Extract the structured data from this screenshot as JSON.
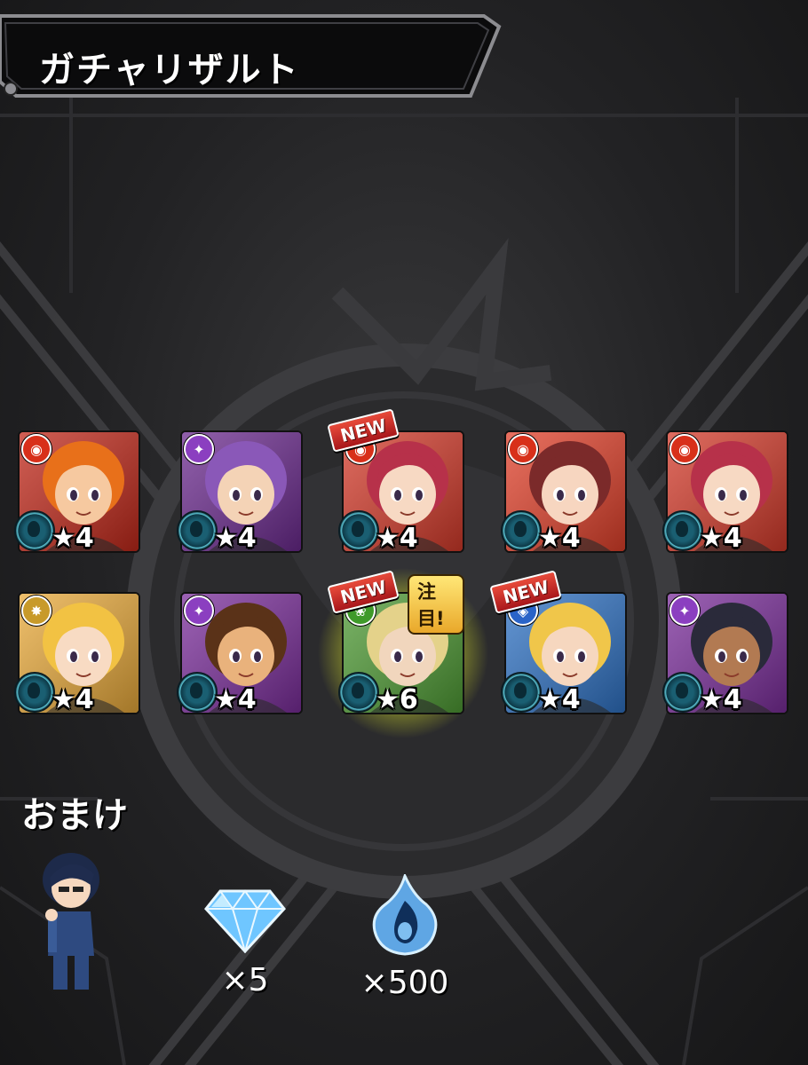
{
  "header": {
    "title": "ガチャリザルト"
  },
  "theme": {
    "background": "#232325",
    "accent_yellow": "#f4e51e",
    "new_badge": "#c4221f"
  },
  "results": [
    {
      "stars": "★4",
      "element": "fire",
      "element_icon": "fire-element-icon",
      "element_color": "#d8301a",
      "bg": "#c0281a",
      "hair": "#e8701a",
      "skin": "#f6c9a0",
      "ability": "ability-orb-icon",
      "is_new": false,
      "is_featured": false
    },
    {
      "stars": "★4",
      "element": "dark",
      "element_icon": "dark-element-icon",
      "element_color": "#8b3fc0",
      "bg": "#6b2a8e",
      "hair": "#8a58b8",
      "skin": "#f4d3b6",
      "ability": "ability-orb-icon",
      "is_new": false,
      "is_featured": false
    },
    {
      "stars": "★4",
      "element": "fire",
      "element_icon": "fire-element-icon",
      "element_color": "#d8301a",
      "bg": "#d33a2a",
      "hair": "#b7314a",
      "skin": "#f7d9c3",
      "ability": "ability-orb-icon",
      "is_new": true,
      "is_featured": false
    },
    {
      "stars": "★4",
      "element": "fire",
      "element_icon": "fire-element-icon",
      "element_color": "#d8301a",
      "bg": "#e0402a",
      "hair": "#7b2a2a",
      "skin": "#f7d6c0",
      "ability": "ability-orb-icon",
      "is_new": false,
      "is_featured": false
    },
    {
      "stars": "★4",
      "element": "fire",
      "element_icon": "fire-element-icon",
      "element_color": "#d8301a",
      "bg": "#d33a2a",
      "hair": "#b7314a",
      "skin": "#f7d9c3",
      "ability": "ability-orb-icon",
      "is_new": false,
      "is_featured": false
    },
    {
      "stars": "★4",
      "element": "light",
      "element_icon": "light-element-icon",
      "element_color": "#c89a2a",
      "bg": "#e8a93a",
      "hair": "#f2c243",
      "skin": "#f8dbc3",
      "ability": "ability-orb-icon",
      "is_new": false,
      "is_featured": false
    },
    {
      "stars": "★4",
      "element": "dark",
      "element_icon": "dark-element-icon",
      "element_color": "#8b3fc0",
      "bg": "#7a2d9a",
      "hair": "#5a3218",
      "skin": "#e9b27c",
      "ability": "ability-orb-icon",
      "is_new": false,
      "is_featured": false
    },
    {
      "stars": "★6",
      "element": "wood",
      "element_icon": "wood-element-icon",
      "element_color": "#3f9a2a",
      "bg": "#4e9a34",
      "hair": "#e4d28a",
      "skin": "#f1d6bd",
      "ability": "ability-orb-icon",
      "is_new": true,
      "is_featured": true
    },
    {
      "stars": "★4",
      "element": "water",
      "element_icon": "water-element-icon",
      "element_color": "#2a64c8",
      "bg": "#2f72c4",
      "hair": "#f0c64a",
      "skin": "#f6d7bf",
      "ability": "ability-orb-icon",
      "is_new": true,
      "is_featured": false
    },
    {
      "stars": "★4",
      "element": "dark",
      "element_icon": "dark-element-icon",
      "element_color": "#8b3fc0",
      "bg": "#7a2d9a",
      "hair": "#2a2a3a",
      "skin": "#b27a52",
      "ability": "ability-orb-icon",
      "is_new": false,
      "is_featured": false
    }
  ],
  "badges": {
    "new_label": "NEW",
    "featured_label": "注目!"
  },
  "bonus": {
    "label": "おまけ",
    "character_icon": "bonus-character-icon",
    "items": [
      {
        "icon": "orb-gem-icon",
        "quantity": "×5"
      },
      {
        "icon": "soul-flame-icon",
        "quantity": "×500"
      }
    ]
  }
}
